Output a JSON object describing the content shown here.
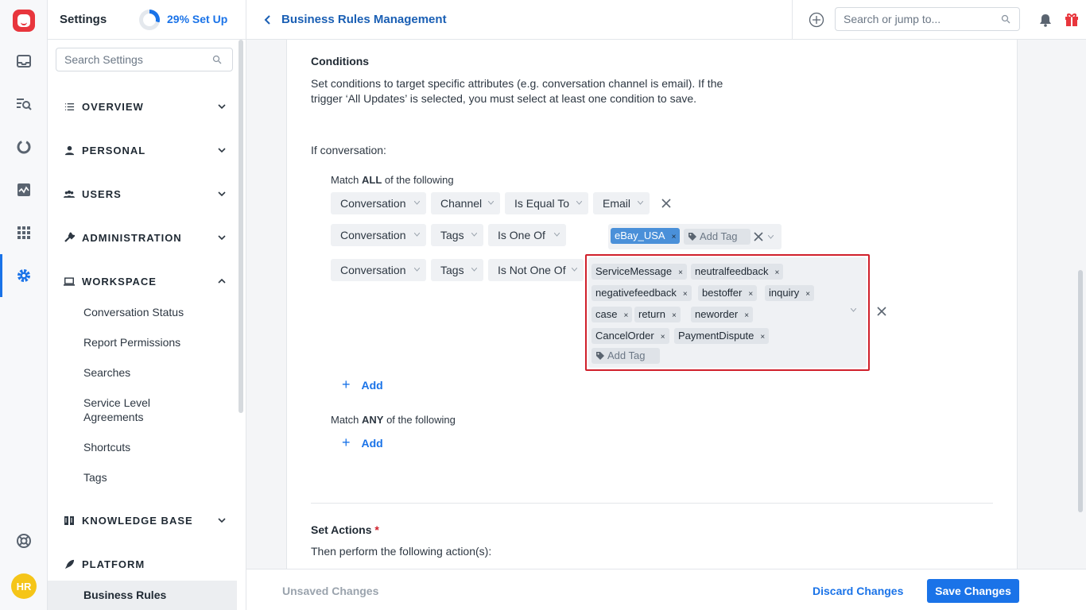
{
  "rail": {
    "icons": [
      "logo-icon",
      "inbox-icon",
      "search-list-icon",
      "reports-icon",
      "analytics-icon",
      "apps-grid-icon",
      "settings-gear-icon",
      "help-icon"
    ],
    "avatar_initials": "HR",
    "accent_color": "#1a73e8"
  },
  "sidebar": {
    "title": "Settings",
    "setup_progress": 0.29,
    "setup_label": "29% Set Up",
    "search_placeholder": "Search Settings",
    "sections": [
      {
        "label": "OVERVIEW",
        "icon": "list-icon",
        "expanded": false
      },
      {
        "label": "PERSONAL",
        "icon": "person-icon",
        "expanded": false
      },
      {
        "label": "USERS",
        "icon": "users-icon",
        "expanded": false
      },
      {
        "label": "ADMINISTRATION",
        "icon": "wrench-icon",
        "expanded": false
      },
      {
        "label": "WORKSPACE",
        "icon": "laptop-icon",
        "expanded": true
      },
      {
        "label": "KNOWLEDGE BASE",
        "icon": "book-icon",
        "expanded": false
      },
      {
        "label": "PLATFORM",
        "icon": "rocket-icon",
        "expanded": true
      }
    ],
    "workspace_items": [
      "Conversation Status",
      "Report Permissions",
      "Searches",
      "Service Level Agreements",
      "Shortcuts",
      "Tags"
    ],
    "platform_items": [
      "Business Rules"
    ]
  },
  "topbar": {
    "title": "Business Rules Management",
    "search_placeholder": "Search or jump to..."
  },
  "conditions": {
    "heading": "Conditions",
    "description": "Set conditions to target specific attributes (e.g. conversation channel is email). If the trigger ‘All Updates’ is selected, you must select at least one condition to save.",
    "if_label": "If conversation:",
    "match_all_prefix": "Match ",
    "match_all_keyword": "ALL",
    "match_all_suffix": " of the following",
    "match_any_prefix": "Match ",
    "match_any_keyword": "ANY",
    "match_any_suffix": " of the following",
    "rows": [
      {
        "object": "Conversation",
        "field": "Channel",
        "operator": "Is Equal To",
        "value": "Email"
      },
      {
        "object": "Conversation",
        "field": "Tags",
        "operator": "Is One Of",
        "tags": [
          "eBay_USA"
        ]
      },
      {
        "object": "Conversation",
        "field": "Tags",
        "operator": "Is Not One Of",
        "tags": [
          "ServiceMessage",
          "neutralfeedback",
          "negativefeedback",
          "bestoffer",
          "inquiry",
          "case",
          "return",
          "neworder",
          "CancelOrder",
          "PaymentDispute"
        ]
      }
    ],
    "add_tag_placeholder": "Add Tag",
    "add_label": "Add",
    "tag_remove_glyph": "×"
  },
  "actions": {
    "heading": "Set Actions",
    "required_mark": "*",
    "description": "Then perform the following action(s):"
  },
  "footer": {
    "unsaved": "Unsaved Changes",
    "discard": "Discard Changes",
    "save": "Save Changes"
  }
}
